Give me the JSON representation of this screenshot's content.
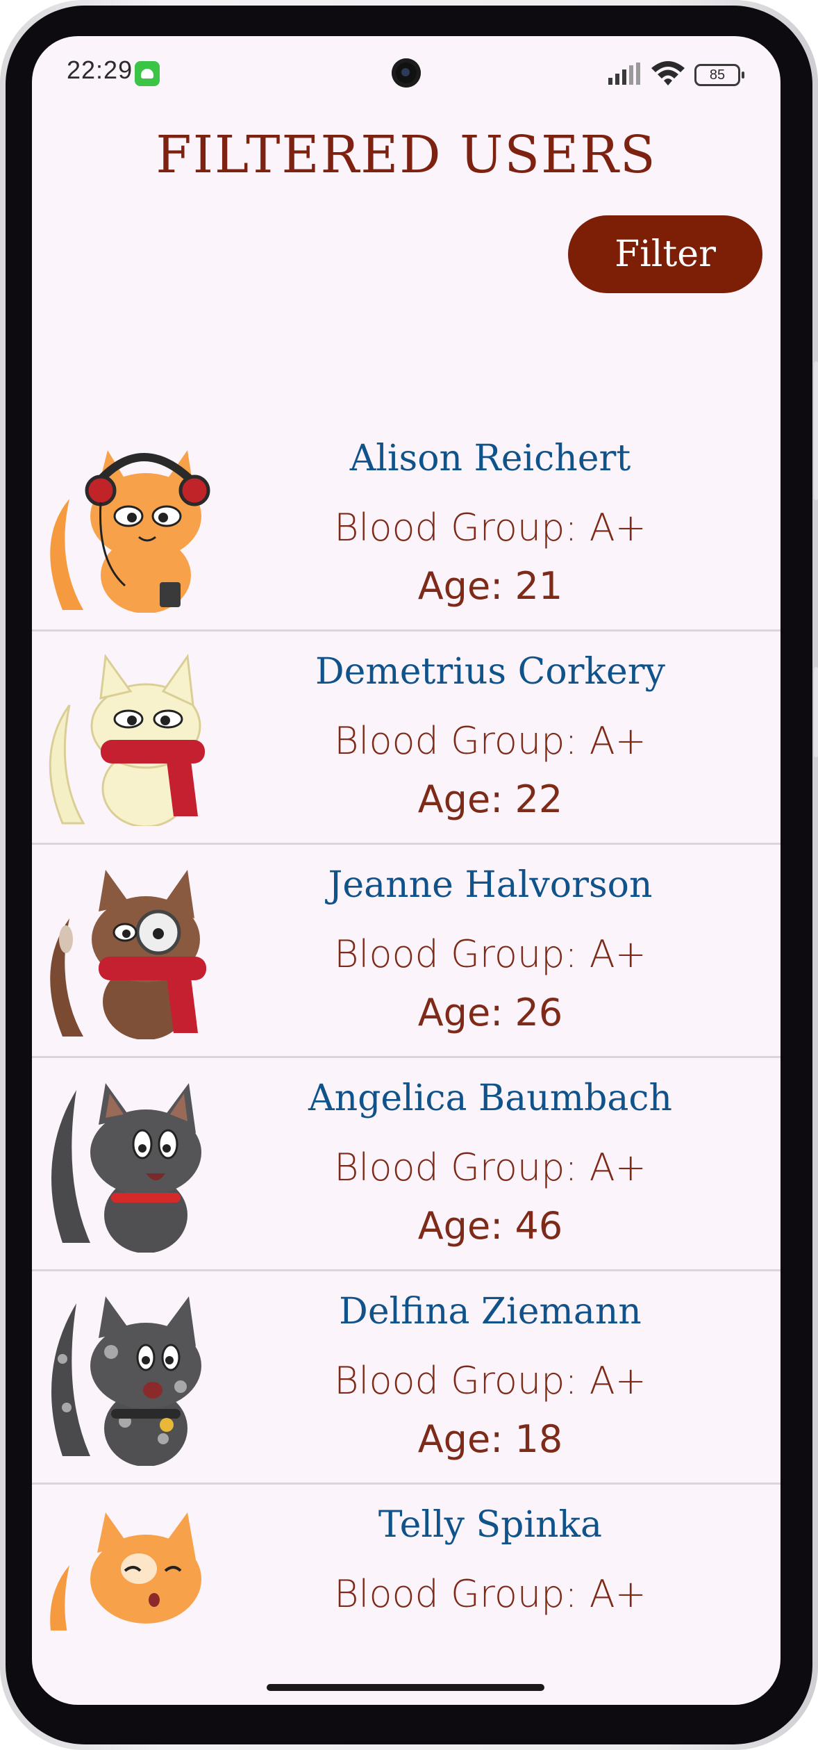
{
  "status_bar": {
    "time": "22:29",
    "battery": "85"
  },
  "header": {
    "title": "FILTERED USERS"
  },
  "toolbar": {
    "filter_label": "Filter"
  },
  "users": [
    {
      "name": "Alison Reichert",
      "blood_group": "Blood Group: A+",
      "age": "Age: 21",
      "avatar": "cat-orange-headphones"
    },
    {
      "name": "Demetrius Corkery",
      "blood_group": "Blood Group: A+",
      "age": "Age: 22",
      "avatar": "cat-cream-red-scarf"
    },
    {
      "name": "Jeanne Halvorson",
      "blood_group": "Blood Group: A+",
      "age": "Age: 26",
      "avatar": "cat-brown-monocle-scarf"
    },
    {
      "name": "Angelica Baumbach",
      "blood_group": "Blood Group: A+",
      "age": "Age: 46",
      "avatar": "cat-gray-collar"
    },
    {
      "name": "Delfina Ziemann",
      "blood_group": "Blood Group: A+",
      "age": "Age: 18",
      "avatar": "cat-spotted-bell"
    },
    {
      "name": "Telly Spinka",
      "blood_group": "Blood Group: A+",
      "avatar": "cat-orange-sleepy"
    }
  ],
  "colors": {
    "title": "#7d2210",
    "filter_button": "#7d1f07",
    "name": "#10538b",
    "detail_text": "#7d2a18",
    "background": "#fcf4fb"
  }
}
